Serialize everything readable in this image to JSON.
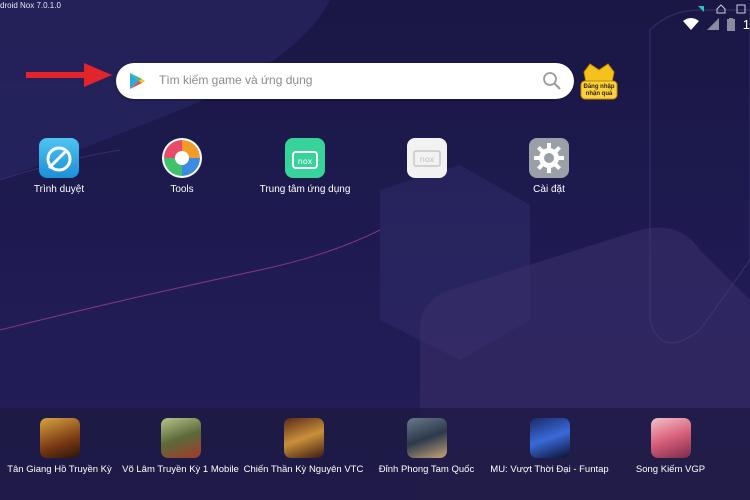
{
  "window": {
    "title": "droid Nox 7.0.1.0"
  },
  "statusbar": {
    "time": "1",
    "icons": [
      "wifi-icon",
      "signal-icon",
      "battery-icon"
    ]
  },
  "search": {
    "placeholder": "Tìm kiếm game và ứng dụng",
    "icon": "play-store-icon",
    "action_icon": "search-icon"
  },
  "login": {
    "line1": "Đăng nhập",
    "line2": "nhận quà"
  },
  "apps": [
    {
      "label": "Trình duyệt",
      "icon": "browser-icon"
    },
    {
      "label": "Tools",
      "icon": "tools-icon"
    },
    {
      "label": "Trung tâm ứng dụng",
      "icon": "app-center-icon"
    },
    {
      "label": "",
      "icon": "nox-icon"
    },
    {
      "label": "Cài đặt",
      "icon": "settings-icon"
    }
  ],
  "dock": [
    {
      "label": "Tân Giang Hồ Truyền Kỳ",
      "icon": "game-icon"
    },
    {
      "label": "Võ Lâm Truyền Kỳ 1 Mobile",
      "icon": "game-icon"
    },
    {
      "label": "Chiến Thần Kỳ Nguyên VTC",
      "icon": "game-icon"
    },
    {
      "label": "Đỉnh Phong Tam Quốc",
      "icon": "game-icon"
    },
    {
      "label": "MU: Vượt Thời Đại - Funtap",
      "icon": "game-icon"
    },
    {
      "label": "Song Kiếm VGP",
      "icon": "game-icon"
    }
  ],
  "colors": {
    "background": "#1d1a4f",
    "arrow": "#e3242b",
    "search_bg": "#ffffff"
  }
}
